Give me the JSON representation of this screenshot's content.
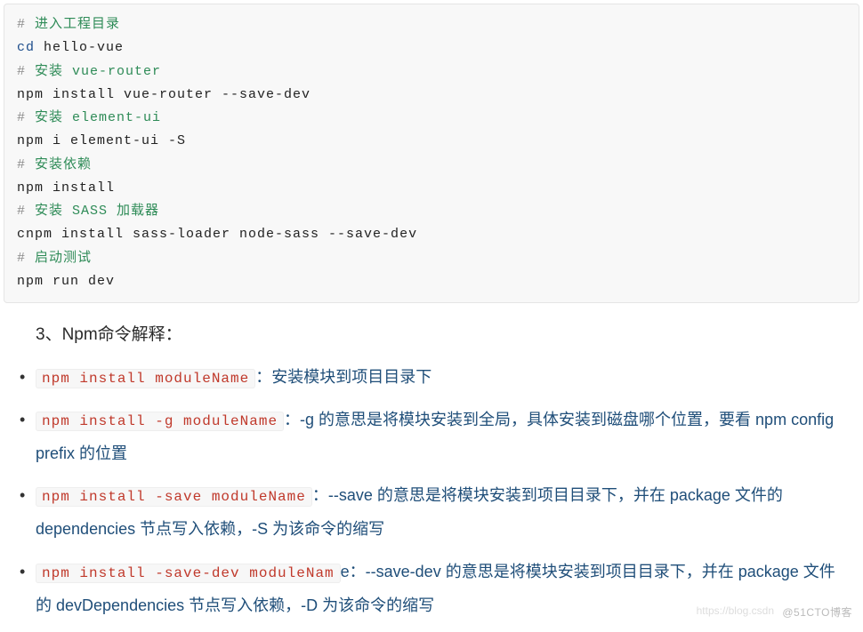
{
  "code": {
    "lines": [
      {
        "comment_hash": "#",
        "comment_text": " 进入工程目录"
      },
      {
        "kw": "cd",
        "rest": " hello-vue"
      },
      {
        "comment_hash": "#",
        "comment_text": " 安装 vue-router"
      },
      {
        "plain": "npm install vue-router --save-dev"
      },
      {
        "comment_hash": "#",
        "comment_text": " 安装 element-ui"
      },
      {
        "plain": "npm i element-ui -S"
      },
      {
        "comment_hash": "#",
        "comment_text": " 安装依赖"
      },
      {
        "plain": "npm install"
      },
      {
        "comment_hash": "#",
        "comment_text": " 安装 SASS 加载器"
      },
      {
        "plain": "cnpm install sass-loader node-sass --save-dev"
      },
      {
        "comment_hash": "#",
        "comment_text": " 启动测试"
      },
      {
        "plain": "npm run dev"
      }
    ]
  },
  "heading": "3、Npm命令解释：",
  "items": [
    {
      "code": "npm install moduleName",
      "text_after": "：安装模块到项目目录下"
    },
    {
      "code": "npm install -g moduleName",
      "text_after": "：-g 的意思是将模块安装到全局，具体安装到磁盘哪个位置，要看 npm config prefix 的位置"
    },
    {
      "code": "npm install -save moduleName",
      "text_after": "：--save 的意思是将模块安装到项目目录下，并在 package 文件的 dependencies 节点写入依赖，-S 为该命令的缩写"
    },
    {
      "code": "npm install -save-dev moduleNam",
      "text_after": "e：--save-dev 的意思是将模块安装到项目目录下，并在 package 文件的 devDependencies 节点写入依赖，-D 为该命令的缩写"
    }
  ],
  "watermark_cto": "@51CTO博客",
  "watermark_csdn": "https://blog.csdn"
}
